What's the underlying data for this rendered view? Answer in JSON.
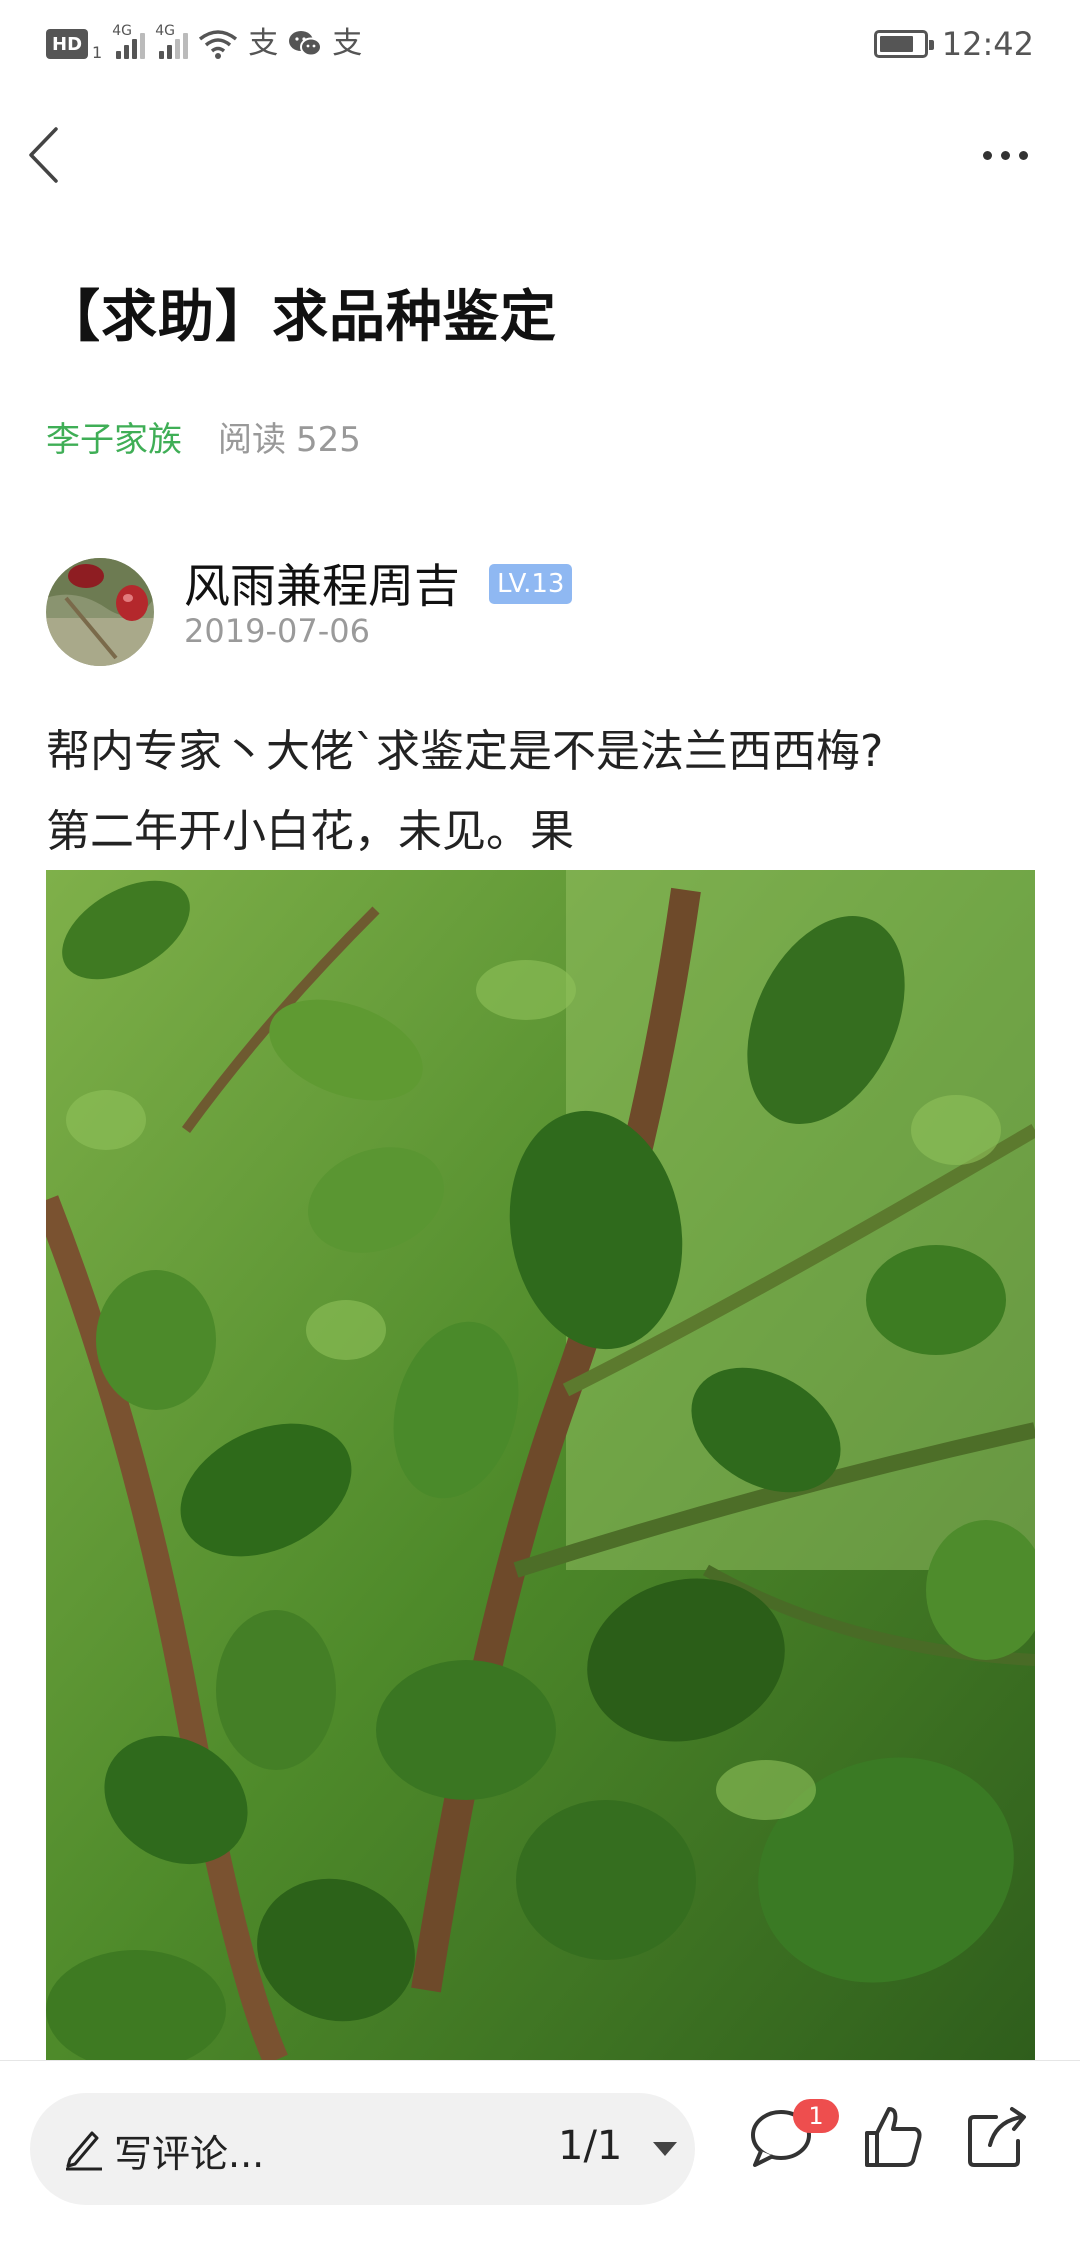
{
  "status_bar": {
    "hd_label": "HD",
    "hd_sub": "1",
    "sim1_label": "4G",
    "sim2_label": "4G",
    "alipay_glyph": "支",
    "time": "12:42",
    "battery_level": 0.8
  },
  "nav": {
    "back_icon": "chevron-left-icon",
    "more_icon": "more-horizontal-icon"
  },
  "post": {
    "title": "【求助】求品种鉴定",
    "group": "李子家族",
    "read_label": "阅读",
    "read_count": "525",
    "author": {
      "name": "风雨兼程周吉",
      "level": "LV.13",
      "date": "2019-07-06"
    },
    "body_line1": "帮内专家丶大佬`求鉴定是不是法兰西西梅?",
    "body_line2": "第二年开小白花，未见。果"
  },
  "bottom_bar": {
    "comment_placeholder": "写评论...",
    "page_indicator": "1/1",
    "comment_badge": "1",
    "icons": [
      "pencil-icon",
      "caret-down-icon",
      "comment-icon",
      "thumbs-up-icon",
      "share-icon"
    ]
  },
  "colors": {
    "group_link": "#3fae56",
    "level_badge": "#8fb8f2",
    "badge": "#ee4e4e"
  }
}
